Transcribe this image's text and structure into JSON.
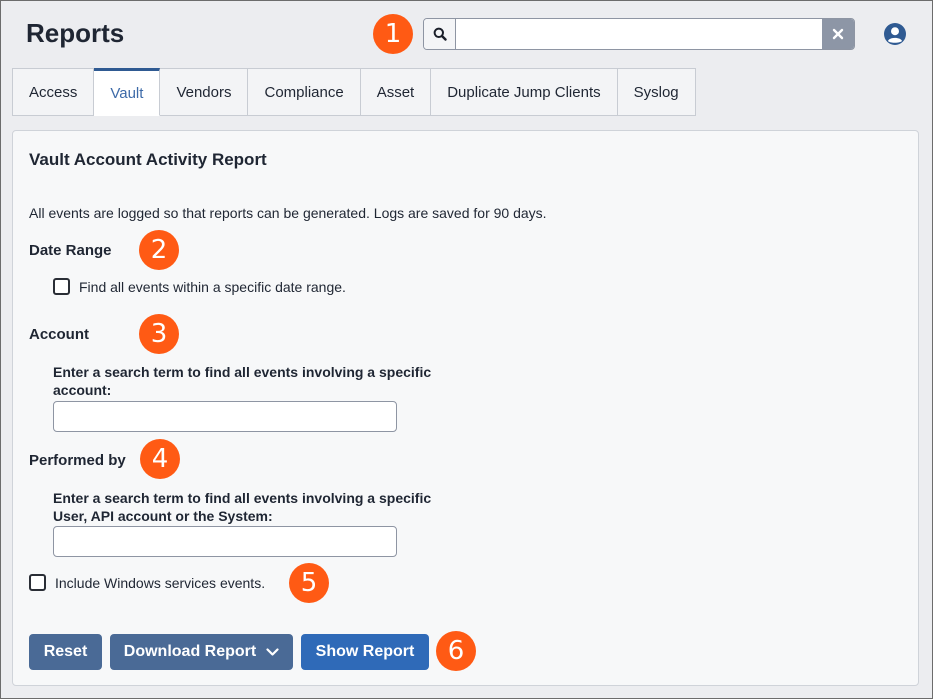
{
  "header": {
    "title": "Reports",
    "search": {
      "value": "",
      "placeholder": ""
    }
  },
  "callouts": [
    "1",
    "2",
    "3",
    "4",
    "5",
    "6"
  ],
  "tabs": [
    {
      "label": "Access",
      "active": false
    },
    {
      "label": "Vault",
      "active": true
    },
    {
      "label": "Vendors",
      "active": false
    },
    {
      "label": "Compliance",
      "active": false
    },
    {
      "label": "Asset",
      "active": false
    },
    {
      "label": "Duplicate Jump Clients",
      "active": false
    },
    {
      "label": "Syslog",
      "active": false
    }
  ],
  "report": {
    "title": "Vault Account Activity Report",
    "intro": "All events are logged so that reports can be generated. Logs are saved for 90 days.",
    "date_range": {
      "heading": "Date Range",
      "checkbox_label": "Find all events within a specific date range.",
      "checked": false
    },
    "account": {
      "heading": "Account",
      "field_label": "Enter a search term to find all events involving a specific account:",
      "value": ""
    },
    "performed_by": {
      "heading": "Performed by",
      "field_label": "Enter a search term to find all events involving a specific User, API account or the System:",
      "value": ""
    },
    "windows_services": {
      "checkbox_label": "Include Windows services events.",
      "checked": false
    }
  },
  "actions": {
    "reset_label": "Reset",
    "download_label": "Download Report",
    "show_label": "Show Report"
  },
  "colors": {
    "callout": "#ff5a14",
    "primary_button": "#2f6ab8",
    "secondary_button": "#4a6a96",
    "active_tab_text": "#3d6aa8"
  },
  "icons": {
    "search": "search-icon",
    "clear": "close-icon",
    "user": "user-circle-icon",
    "dropdown": "chevron-down-icon"
  }
}
